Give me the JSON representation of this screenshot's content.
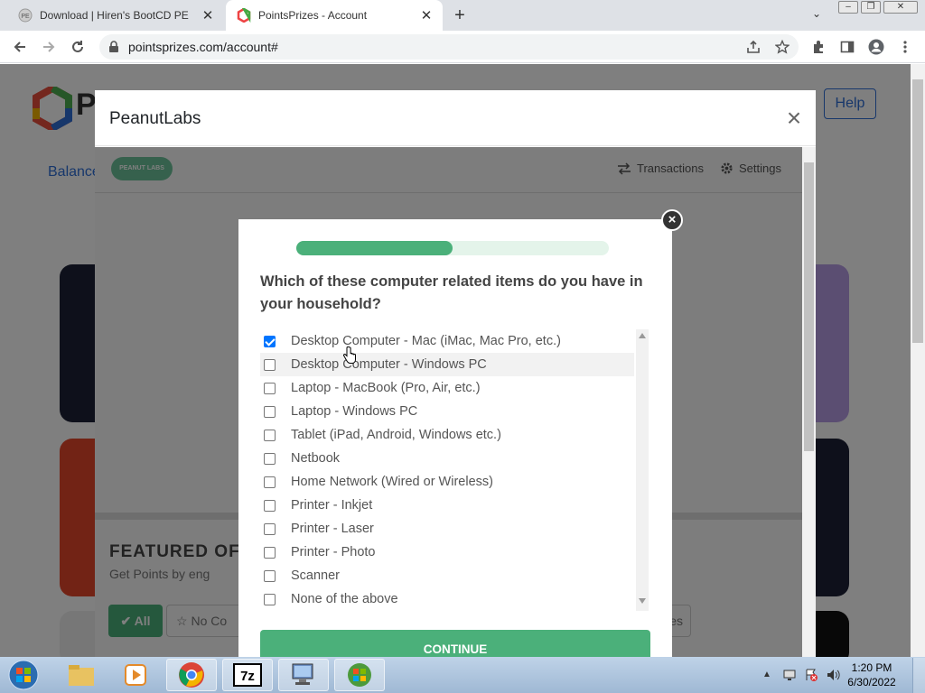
{
  "browser": {
    "tabs": [
      {
        "title": "Download | Hiren's BootCD PE",
        "active": false
      },
      {
        "title": "PointsPrizes - Account",
        "active": true
      }
    ],
    "url": "pointsprizes.com/account#"
  },
  "page": {
    "help_label": "Help",
    "balance_label": "Balance",
    "logo_text": "P",
    "featured_heading": "FEATURED OF",
    "featured_sub": "Get Points by eng",
    "filter_all": "All",
    "filter_no": "No Co",
    "tab_right_frag": "es"
  },
  "modal": {
    "title": "PeanutLabs",
    "close": "×",
    "nav": {
      "brand": "PEANUT LABS",
      "transactions": "Transactions",
      "settings": "Settings"
    }
  },
  "survey": {
    "close": "×",
    "progress": 0.5,
    "question": "Which of these computer related items do you have in your household?",
    "options": [
      {
        "label": "Desktop Computer - Mac (iMac, Mac Pro, etc.)",
        "checked": true
      },
      {
        "label": "Desktop Computer - Windows PC",
        "checked": false
      },
      {
        "label": "Laptop - MacBook (Pro, Air, etc.)",
        "checked": false
      },
      {
        "label": "Laptop - Windows PC",
        "checked": false
      },
      {
        "label": "Tablet (iPad, Android, Windows etc.)",
        "checked": false
      },
      {
        "label": "Netbook",
        "checked": false
      },
      {
        "label": "Home Network (Wired or Wireless)",
        "checked": false
      },
      {
        "label": "Printer - Inkjet",
        "checked": false
      },
      {
        "label": "Printer - Laser",
        "checked": false
      },
      {
        "label": "Printer - Photo",
        "checked": false
      },
      {
        "label": "Scanner",
        "checked": false
      },
      {
        "label": "None of the above",
        "checked": false
      }
    ],
    "continue_label": "CONTINUE"
  },
  "taskbar": {
    "time": "1:20 PM",
    "date": "6/30/2022",
    "apps": [
      "start-orb",
      "explorer",
      "media-player",
      "chrome",
      "7zip",
      "network-tool",
      "windows-app"
    ]
  },
  "colors": {
    "accent_green": "#4bb07a",
    "checkbox_blue": "#0075ff",
    "help_blue": "#2f6fd6"
  }
}
